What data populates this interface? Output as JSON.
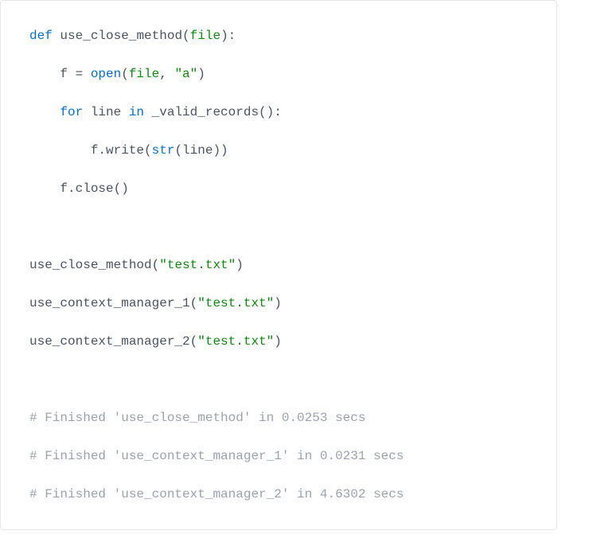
{
  "code": {
    "tokens": [
      [
        {
          "cls": "tok-keyword",
          "t": "def"
        },
        {
          "cls": "tok-plain",
          "t": " "
        },
        {
          "cls": "tok-func",
          "t": "use_close_method"
        },
        {
          "cls": "tok-plain",
          "t": "("
        },
        {
          "cls": "tok-param",
          "t": "file"
        },
        {
          "cls": "tok-plain",
          "t": "):"
        }
      ],
      [],
      [
        {
          "cls": "tok-plain",
          "t": "    f = "
        },
        {
          "cls": "tok-builtin",
          "t": "open"
        },
        {
          "cls": "tok-plain",
          "t": "("
        },
        {
          "cls": "tok-param",
          "t": "file"
        },
        {
          "cls": "tok-plain",
          "t": ", "
        },
        {
          "cls": "tok-string",
          "t": "\"a\""
        },
        {
          "cls": "tok-plain",
          "t": ")"
        }
      ],
      [],
      [
        {
          "cls": "tok-plain",
          "t": "    "
        },
        {
          "cls": "tok-keyword",
          "t": "for"
        },
        {
          "cls": "tok-plain",
          "t": " line "
        },
        {
          "cls": "tok-keyword",
          "t": "in"
        },
        {
          "cls": "tok-plain",
          "t": " _valid_records():"
        }
      ],
      [],
      [
        {
          "cls": "tok-plain",
          "t": "        f.write("
        },
        {
          "cls": "tok-builtin",
          "t": "str"
        },
        {
          "cls": "tok-plain",
          "t": "(line))"
        }
      ],
      [],
      [
        {
          "cls": "tok-plain",
          "t": "    f.close()"
        }
      ],
      [],
      [],
      [],
      [
        {
          "cls": "tok-func",
          "t": "use_close_method"
        },
        {
          "cls": "tok-plain",
          "t": "("
        },
        {
          "cls": "tok-string",
          "t": "\"test.txt\""
        },
        {
          "cls": "tok-plain",
          "t": ")"
        }
      ],
      [],
      [
        {
          "cls": "tok-func",
          "t": "use_context_manager_1"
        },
        {
          "cls": "tok-plain",
          "t": "("
        },
        {
          "cls": "tok-string",
          "t": "\"test.txt\""
        },
        {
          "cls": "tok-plain",
          "t": ")"
        }
      ],
      [],
      [
        {
          "cls": "tok-func",
          "t": "use_context_manager_2"
        },
        {
          "cls": "tok-plain",
          "t": "("
        },
        {
          "cls": "tok-string",
          "t": "\"test.txt\""
        },
        {
          "cls": "tok-plain",
          "t": ")"
        }
      ],
      [],
      [],
      [],
      [
        {
          "cls": "tok-comment",
          "t": "# Finished 'use_close_method' in 0.0253 secs"
        }
      ],
      [],
      [
        {
          "cls": "tok-comment",
          "t": "# Finished 'use_context_manager_1' in 0.0231 secs"
        }
      ],
      [],
      [
        {
          "cls": "tok-comment",
          "t": "# Finished 'use_context_manager_2' in 4.6302 secs"
        }
      ]
    ]
  }
}
